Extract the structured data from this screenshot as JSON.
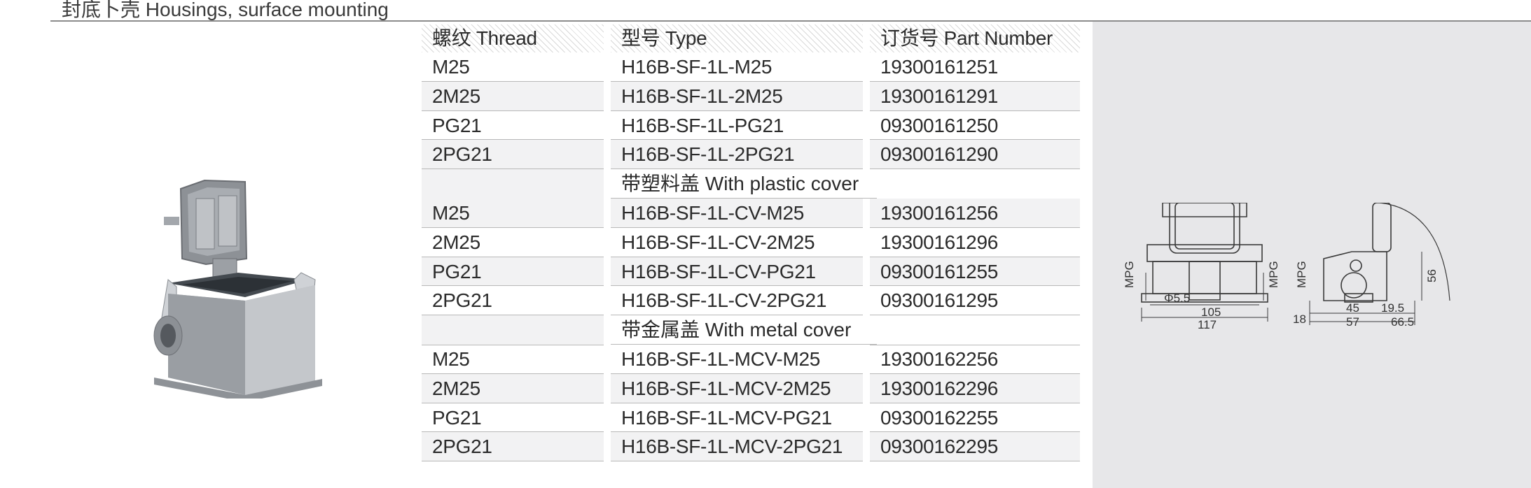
{
  "header": {
    "title": "封底卜壳 Housings, surface mounting"
  },
  "table": {
    "columns": [
      "螺纹 Thread",
      "型号 Type",
      "订货号 Part Number"
    ],
    "rows": [
      {
        "thread": "M25",
        "type": "H16B-SF-1L-M25",
        "part": "19300161251"
      },
      {
        "thread": "2M25",
        "type": "H16B-SF-1L-2M25",
        "part": "19300161291"
      },
      {
        "thread": "PG21",
        "type": "H16B-SF-1L-PG21",
        "part": "09300161250"
      },
      {
        "thread": "2PG21",
        "type": "H16B-SF-1L-2PG21",
        "part": "09300161290"
      }
    ],
    "section_plastic": "带塑料盖 With plastic cover",
    "rows_plastic": [
      {
        "thread": "M25",
        "type": "H16B-SF-1L-CV-M25",
        "part": "19300161256"
      },
      {
        "thread": "2M25",
        "type": "H16B-SF-1L-CV-2M25",
        "part": "19300161296"
      },
      {
        "thread": "PG21",
        "type": "H16B-SF-1L-CV-PG21",
        "part": "09300161255"
      },
      {
        "thread": "2PG21",
        "type": "H16B-SF-1L-CV-2PG21",
        "part": "09300161295"
      }
    ],
    "section_metal": "带金属盖 With metal cover",
    "rows_metal": [
      {
        "thread": "M25",
        "type": "H16B-SF-1L-MCV-M25",
        "part": "19300162256"
      },
      {
        "thread": "2M25",
        "type": "H16B-SF-1L-MCV-2M25",
        "part": "19300162296"
      },
      {
        "thread": "PG21",
        "type": "H16B-SF-1L-MCV-PG21",
        "part": "09300162255"
      },
      {
        "thread": "2PG21",
        "type": "H16B-SF-1L-MCV-2PG21",
        "part": "09300162295"
      }
    ]
  },
  "drawing": {
    "labels": {
      "phi": "Φ5.5",
      "w105": "105",
      "w117": "117",
      "mpg": "MPG",
      "d18": "18",
      "d45": "45",
      "d57": "57",
      "d195": "19.5",
      "d665": "66.5",
      "h56": "56"
    }
  },
  "colors": {
    "rule": "#8c8c8c",
    "panel": "#e7e7e9",
    "row_shade": "#f2f2f3"
  }
}
